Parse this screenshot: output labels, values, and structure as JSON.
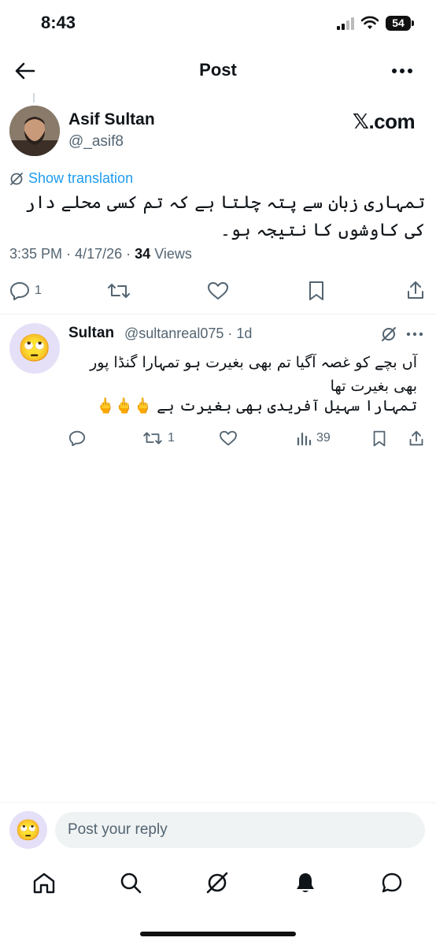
{
  "status_bar": {
    "time": "8:43",
    "battery": "54"
  },
  "header": {
    "title": "Post",
    "back_icon": "arrow-left-icon",
    "more_icon": "more-horizontal-icon"
  },
  "post": {
    "author_name": "Asif Sultan",
    "author_handle": "@_asif8",
    "brand_text": "𝕏.com",
    "translate_label": "Show translation",
    "text": "تمہاری زبان سے پتہ چلتا ہے کہ تم کسی محلے دار کی کاوشوں کا نتیجہ ہو۔",
    "time": "3:35 PM",
    "date": "4/17/26",
    "views_count": "34",
    "views_label": "Views",
    "reply_count": "1"
  },
  "reply": {
    "name": "Sultan",
    "handle_time": "@sultanreal075 · 1d",
    "text_line1": "آں بچے کو غصہ آگیا تم بھی بغیرت ہو تمہارا گنڈا پور بھی بغیرت تھا",
    "text_line2": "تمہارا سہیل آفریدی بھی بغیرت ہے 🖕🖕🖕",
    "avatar_emoji": "🙄",
    "retweet_count": "1",
    "views_count": "39"
  },
  "composer": {
    "placeholder": "Post your reply",
    "avatar_emoji": "🙄"
  },
  "bottom_nav": {
    "items": [
      "home-icon",
      "search-icon",
      "grok-icon",
      "notifications-icon",
      "messages-icon"
    ]
  },
  "colors": {
    "accent": "#1d9bf0",
    "secondary_text": "#536471",
    "divider": "#eff3f4"
  }
}
